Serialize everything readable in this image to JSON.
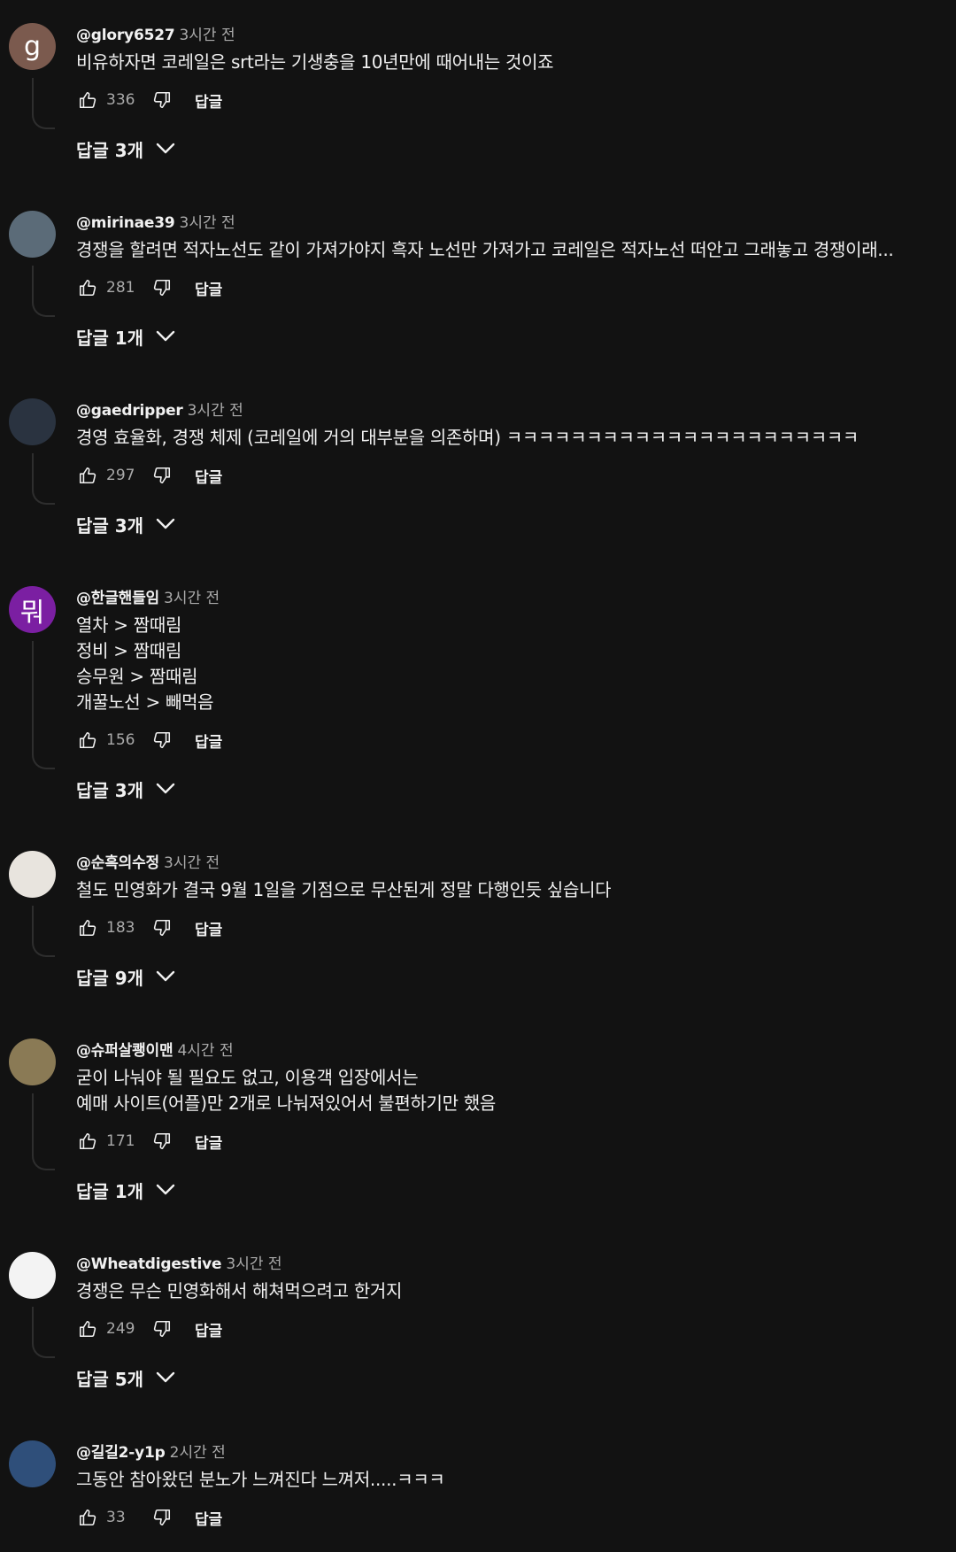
{
  "comments": [
    {
      "author": "@glory6527",
      "time": "3시간 전",
      "lines": [
        "비유하자면 코레일은 srt라는 기생충을 10년만에 때어내는 것이죠"
      ],
      "likes": "336",
      "reply_label": "답글",
      "replies_label": "답글 3개",
      "avatar": {
        "letter": "g",
        "color": "#7b5a4e"
      }
    },
    {
      "author": "@mirinae39",
      "time": "3시간 전",
      "lines": [
        "경쟁을 할려면 적자노선도 같이 가져가야지 흑자 노선만 가져가고 코레일은 적자노선 떠안고 그래놓고 경쟁이래..."
      ],
      "likes": "281",
      "reply_label": "답글",
      "replies_label": "답글 1개",
      "avatar": {
        "letter": "",
        "color": "#5b6b78"
      }
    },
    {
      "author": "@gaedripper",
      "time": "3시간 전",
      "lines": [
        "경영 효율화, 경쟁 체제 (코레일에 거의 대부분을 의존하며) ㅋㅋㅋㅋㅋㅋㅋㅋㅋㅋㅋㅋㅋㅋㅋㅋㅋㅋㅋㅋㅋㅋ"
      ],
      "likes": "297",
      "reply_label": "답글",
      "replies_label": "답글 3개",
      "avatar": {
        "letter": "",
        "color": "#2a3340"
      }
    },
    {
      "author": "@한글핸들임",
      "time": "3시간 전",
      "lines": [
        "열차 > 짬때림",
        "정비 > 짬때림",
        "승무원 > 짬때림",
        "개꿀노선 > 빼먹음"
      ],
      "likes": "156",
      "reply_label": "답글",
      "replies_label": "답글 3개",
      "avatar": {
        "letter": "뭐",
        "color": "#7b1fa2"
      }
    },
    {
      "author": "@순흑의수정",
      "time": "3시간 전",
      "lines": [
        "철도 민영화가 결국 9월 1일을 기점으로 무산된게 정말 다행인듯 싶습니다"
      ],
      "likes": "183",
      "reply_label": "답글",
      "replies_label": "답글 9개",
      "avatar": {
        "letter": "",
        "color": "#e8e4de"
      }
    },
    {
      "author": "@슈퍼살쾡이맨",
      "time": "4시간 전",
      "lines": [
        "굳이 나눠야 될 필요도 없고, 이용객 입장에서는",
        "예매 사이트(어플)만 2개로 나눠져있어서 불편하기만 했음"
      ],
      "likes": "171",
      "reply_label": "답글",
      "replies_label": "답글 1개",
      "avatar": {
        "letter": "",
        "color": "#8a7a55"
      }
    },
    {
      "author": "@Wheatdigestive",
      "time": "3시간 전",
      "lines": [
        "경쟁은 무슨 민영화해서 해쳐먹으려고 한거지"
      ],
      "likes": "249",
      "reply_label": "답글",
      "replies_label": "답글 5개",
      "avatar": {
        "letter": "",
        "color": "#f3f3f3"
      }
    },
    {
      "author": "@길길2-y1p",
      "time": "2시간 전",
      "lines": [
        "그동안 참아왔던 분노가 느껴진다 느껴저.....ㅋㅋㅋ"
      ],
      "likes": "33",
      "reply_label": "답글",
      "replies_label": "",
      "avatar": {
        "letter": "",
        "color": "#2f4f7a"
      }
    }
  ]
}
